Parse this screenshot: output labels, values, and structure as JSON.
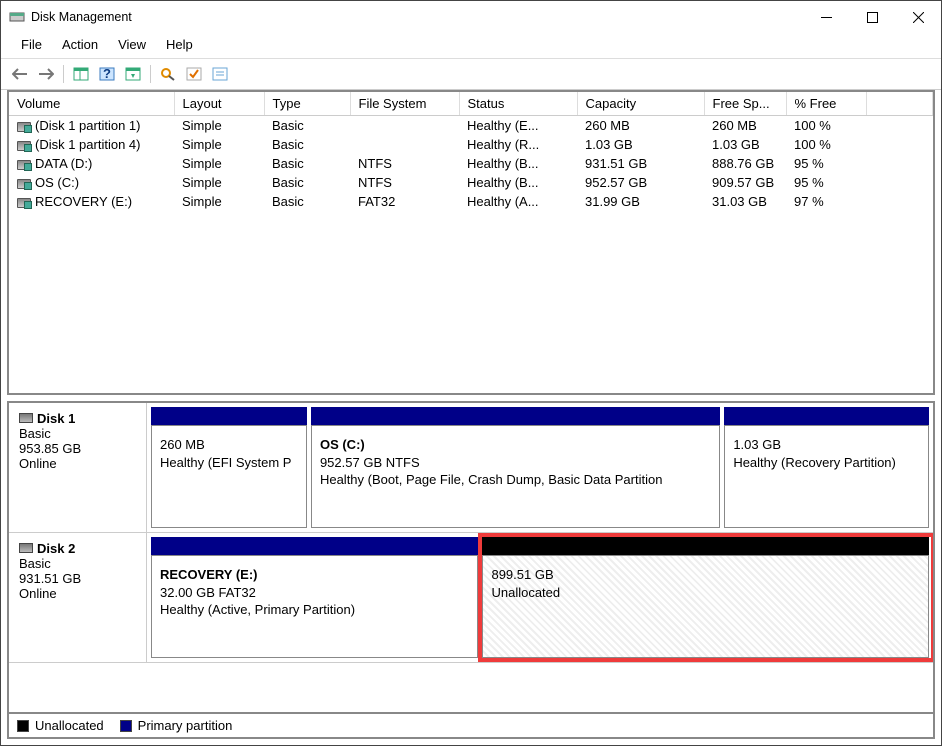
{
  "title": "Disk Management",
  "menu": {
    "file": "File",
    "action": "Action",
    "view": "View",
    "help": "Help"
  },
  "columns": [
    "Volume",
    "Layout",
    "Type",
    "File System",
    "Status",
    "Capacity",
    "Free Sp...",
    "% Free"
  ],
  "volumes": [
    {
      "name": "(Disk 1 partition 1)",
      "layout": "Simple",
      "dtype": "Basic",
      "fs": "",
      "status": "Healthy (E...",
      "cap": "260 MB",
      "free": "260 MB",
      "pct": "100 %"
    },
    {
      "name": "(Disk 1 partition 4)",
      "layout": "Simple",
      "dtype": "Basic",
      "fs": "",
      "status": "Healthy (R...",
      "cap": "1.03 GB",
      "free": "1.03 GB",
      "pct": "100 %"
    },
    {
      "name": "DATA (D:)",
      "layout": "Simple",
      "dtype": "Basic",
      "fs": "NTFS",
      "status": "Healthy (B...",
      "cap": "931.51 GB",
      "free": "888.76 GB",
      "pct": "95 %"
    },
    {
      "name": "OS (C:)",
      "layout": "Simple",
      "dtype": "Basic",
      "fs": "NTFS",
      "status": "Healthy (B...",
      "cap": "952.57 GB",
      "free": "909.57 GB",
      "pct": "95 %"
    },
    {
      "name": "RECOVERY (E:)",
      "layout": "Simple",
      "dtype": "Basic",
      "fs": "FAT32",
      "status": "Healthy (A...",
      "cap": "31.99 GB",
      "free": "31.03 GB",
      "pct": "97 %"
    }
  ],
  "disks": [
    {
      "label": "Disk 1",
      "dtype": "Basic",
      "size": "953.85 GB",
      "state": "Online",
      "parts": [
        {
          "title": "",
          "line1": "260 MB",
          "line2": "Healthy (EFI System P",
          "headColor": "blue",
          "flex": 16
        },
        {
          "title": "OS  (C:)",
          "line1": "952.57 GB NTFS",
          "line2": "Healthy (Boot, Page File, Crash Dump, Basic Data Partition",
          "headColor": "blue",
          "flex": 42
        },
        {
          "title": "",
          "line1": "1.03 GB",
          "line2": "Healthy (Recovery Partition)",
          "headColor": "blue",
          "flex": 21
        }
      ]
    },
    {
      "label": "Disk 2",
      "dtype": "Basic",
      "size": "931.51 GB",
      "state": "Online",
      "parts": [
        {
          "title": "RECOVERY  (E:)",
          "line1": "32.00 GB FAT32",
          "line2": "Healthy (Active, Primary Partition)",
          "headColor": "blue",
          "flex": 33
        },
        {
          "title": "",
          "line1": "899.51 GB",
          "line2": "Unallocated",
          "headColor": "black",
          "flex": 45,
          "unalloc": true,
          "highlight": true
        }
      ]
    }
  ],
  "legend": {
    "unalloc": "Unallocated",
    "primary": "Primary partition"
  }
}
